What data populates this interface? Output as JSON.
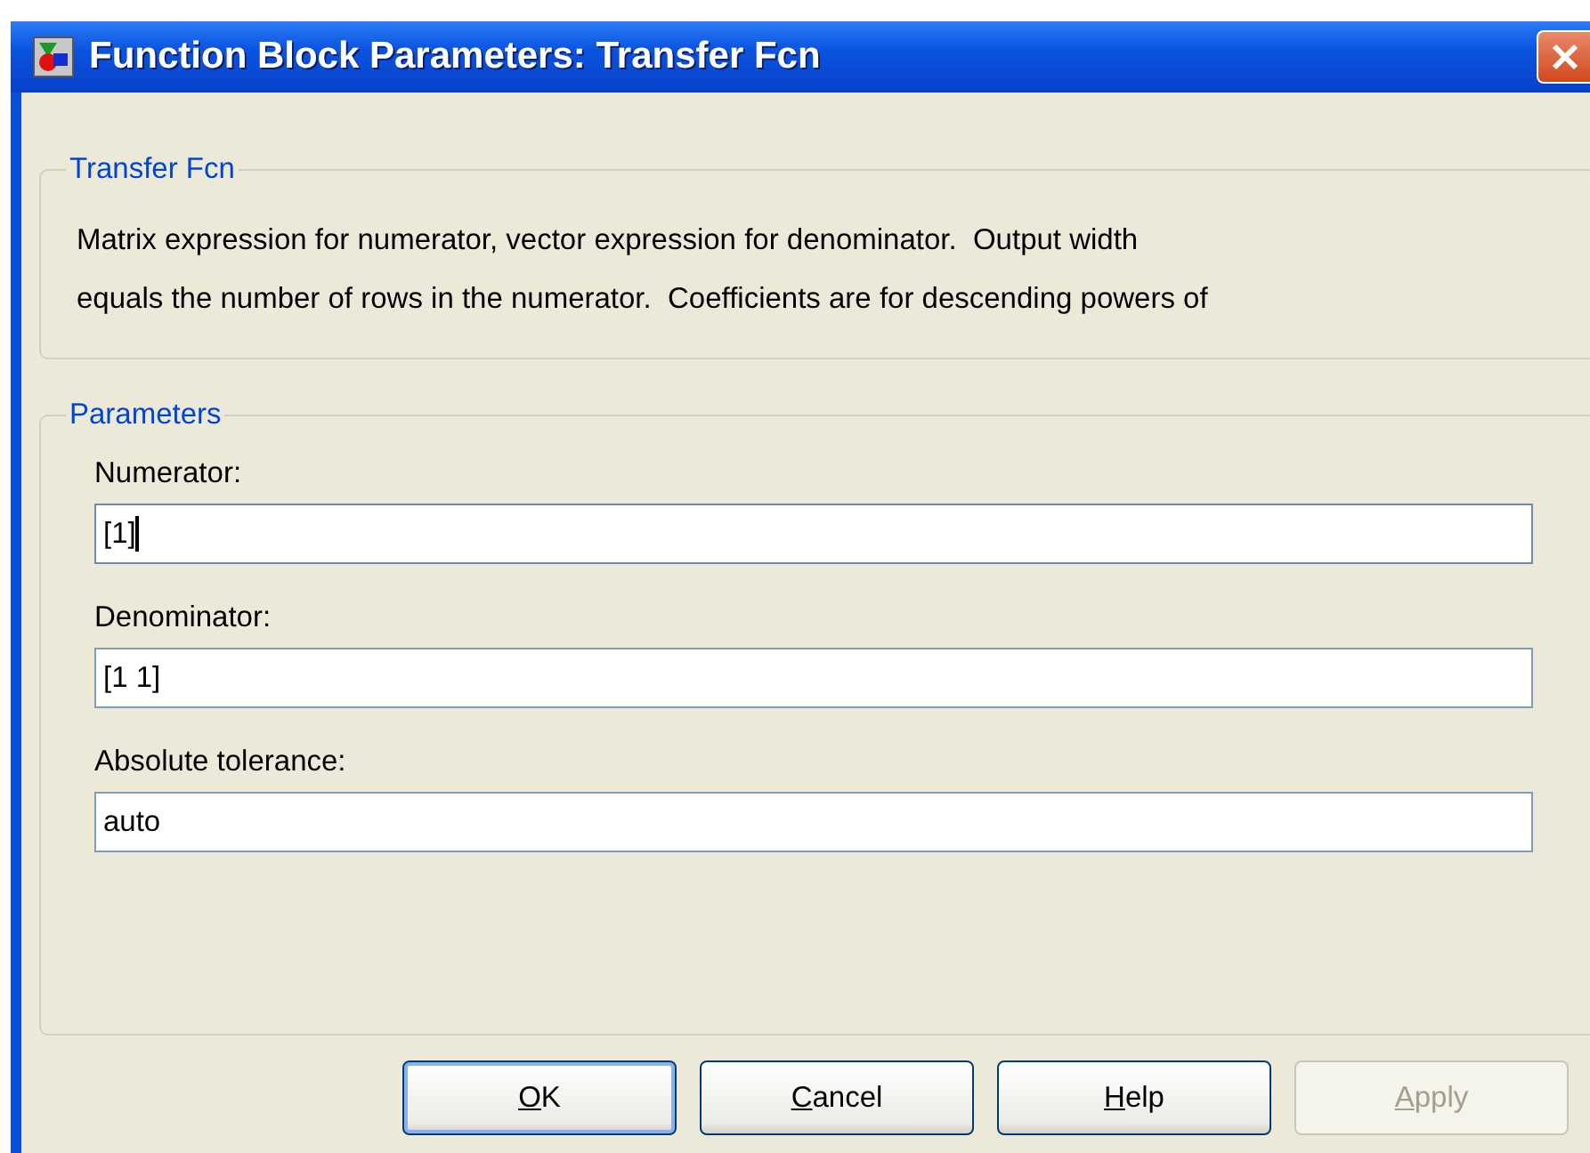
{
  "window": {
    "title": "Function Block Parameters: Transfer Fcn"
  },
  "description_group": {
    "title": "Transfer Fcn",
    "lines": [
      "Matrix expression for numerator, vector expression for denominator.  Output width",
      "equals the number of rows in the numerator.  Coefficients are for descending powers of"
    ]
  },
  "parameters_group": {
    "title": "Parameters",
    "fields": [
      {
        "label": "Numerator:",
        "value": "[1]",
        "focused": true
      },
      {
        "label": "Denominator:",
        "value": "[1 1]",
        "focused": false
      },
      {
        "label": "Absolute tolerance:",
        "value": "auto",
        "focused": false
      }
    ]
  },
  "buttons": [
    {
      "mnemonic": "O",
      "rest": "K",
      "default": true,
      "disabled": false
    },
    {
      "mnemonic": "C",
      "rest": "ancel",
      "default": false,
      "disabled": false
    },
    {
      "mnemonic": "H",
      "rest": "elp",
      "default": false,
      "disabled": false
    },
    {
      "mnemonic": "A",
      "rest": "pply",
      "default": false,
      "disabled": true
    }
  ]
}
